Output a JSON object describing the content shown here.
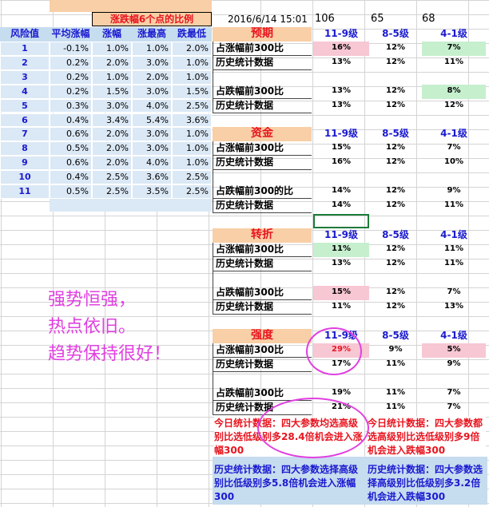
{
  "header": {
    "title": "涨跌幅6个点的比例",
    "datetime": "2016/6/14  15:01",
    "n1": "106",
    "n2": "65",
    "n3": "68"
  },
  "left_table": {
    "headers": [
      "风险值",
      "平均涨幅",
      "涨幅",
      "涨最高",
      "跌最低"
    ],
    "rows": [
      [
        "1",
        "-0.1%",
        "1.0%",
        "1.0%",
        "2.0%"
      ],
      [
        "2",
        "0.2%",
        "2.0%",
        "3.0%",
        "1.0%"
      ],
      [
        "3",
        "0.2%",
        "1.0%",
        "2.0%",
        "1.0%"
      ],
      [
        "4",
        "0.2%",
        "1.5%",
        "3.0%",
        "1.5%"
      ],
      [
        "5",
        "0.3%",
        "3.0%",
        "4.0%",
        "2.5%"
      ],
      [
        "6",
        "0.4%",
        "3.4%",
        "5.4%",
        "3.6%"
      ],
      [
        "7",
        "0.6%",
        "2.0%",
        "3.0%",
        "1.0%"
      ],
      [
        "8",
        "0.5%",
        "2.0%",
        "3.0%",
        "1.0%"
      ],
      [
        "9",
        "0.6%",
        "2.0%",
        "4.0%",
        "1.0%"
      ],
      [
        "10",
        "0.4%",
        "2.5%",
        "3.6%",
        "2.5%"
      ],
      [
        "11",
        "0.5%",
        "2.5%",
        "3.5%",
        "2.5%"
      ]
    ]
  },
  "levels": [
    "11-9级",
    "8-5级",
    "4-1级"
  ],
  "sections": [
    {
      "title": "预期",
      "rows": [
        {
          "label": "占涨幅前300比",
          "v": [
            "16%",
            "12%",
            "7%"
          ]
        },
        {
          "label": "历史统计数据",
          "v": [
            "13%",
            "12%",
            "11%"
          ]
        },
        {
          "label": "",
          "v": [
            "",
            "",
            ""
          ]
        },
        {
          "label": "占跌幅前300比",
          "v": [
            "13%",
            "12%",
            "8%"
          ]
        },
        {
          "label": "历史统计数据",
          "v": [
            "13%",
            "12%",
            "12%"
          ]
        }
      ]
    },
    {
      "title": "资金",
      "rows": [
        {
          "label": "占涨幅前300比",
          "v": [
            "15%",
            "12%",
            "7%"
          ]
        },
        {
          "label": "历史统计数据",
          "v": [
            "16%",
            "12%",
            "10%"
          ]
        },
        {
          "label": "",
          "v": [
            "",
            "",
            ""
          ]
        },
        {
          "label": "占跌幅前300的比",
          "v": [
            "14%",
            "12%",
            "9%"
          ]
        },
        {
          "label": "历史统计数据",
          "v": [
            "14%",
            "12%",
            "11%"
          ]
        }
      ]
    },
    {
      "title": "转折",
      "rows": [
        {
          "label": "占涨幅前300比",
          "v": [
            "11%",
            "12%",
            "11%"
          ]
        },
        {
          "label": "历史统计数据",
          "v": [
            "13%",
            "12%",
            "11%"
          ]
        },
        {
          "label": "",
          "v": [
            "",
            "",
            ""
          ]
        },
        {
          "label": "占跌幅前300比",
          "v": [
            "15%",
            "12%",
            "7%"
          ]
        },
        {
          "label": "历史统计数据",
          "v": [
            "11%",
            "12%",
            "13%"
          ]
        }
      ]
    },
    {
      "title": "强度",
      "rows": [
        {
          "label": "占涨幅前300比",
          "v": [
            "29%",
            "9%",
            "5%"
          ]
        },
        {
          "label": "历史统计数据",
          "v": [
            "17%",
            "11%",
            "9%"
          ]
        },
        {
          "label": "",
          "v": [
            "",
            "",
            ""
          ]
        },
        {
          "label": "占跌幅前300比",
          "v": [
            "19%",
            "11%",
            "7%"
          ]
        },
        {
          "label": "历史统计数据",
          "v": [
            "21%",
            "11%",
            "7%"
          ]
        }
      ]
    }
  ],
  "notes": {
    "today_up": "今日统计数据：四大参数均选高级别比选低级别多28.4倍机会进入涨幅300",
    "today_down": "今日统计数据：四大参数都选高级别比选低级别多9倍机会进入跌幅300",
    "hist_up": "历史统计数据：四大参数选择高级别比低级别多5.8倍机会进入涨幅300",
    "hist_down": "历史统计数据：四大参数选择高级别比低级别多3.2倍机会进入跌幅300"
  },
  "handwriting": [
    "强势恒强，",
    "热点依旧。",
    "趋势保持很好！"
  ],
  "colors": {
    "title_red": "#e8141e",
    "header_blue": "#1a1ad0",
    "highlight_pink": "#f7c7d4",
    "highlight_green": "#c6efce",
    "annotation_magenta": "#e040e0"
  }
}
